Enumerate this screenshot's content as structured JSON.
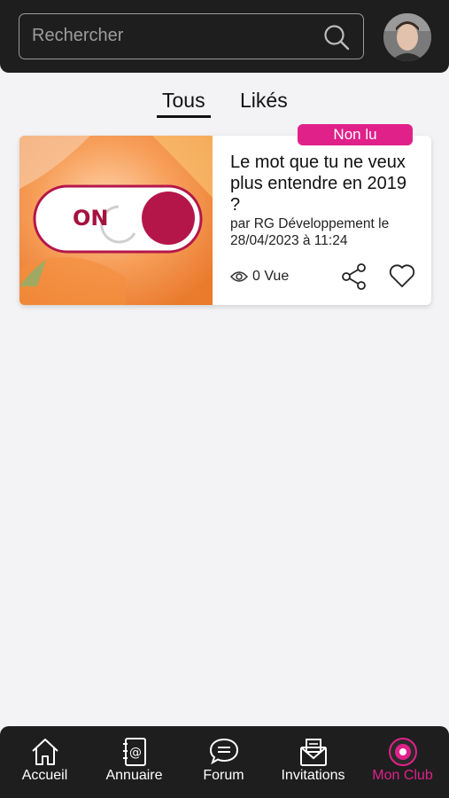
{
  "search": {
    "placeholder": "Rechercher"
  },
  "tabs": [
    {
      "label": "Tous",
      "active": true
    },
    {
      "label": "Likés",
      "active": false
    }
  ],
  "article": {
    "badge": "Non lu",
    "title": "Le mot que tu ne veux plus entendre en 2019 ?",
    "meta": "par RG Développement le 28/04/2023 à 11:24",
    "views": "0 Vue",
    "thumb_text": "ON"
  },
  "nav": [
    {
      "label": "Accueil",
      "icon": "home-icon"
    },
    {
      "label": "Annuaire",
      "icon": "address-book-icon"
    },
    {
      "label": "Forum",
      "icon": "chat-bubbles-icon"
    },
    {
      "label": "Invitations",
      "icon": "envelope-icon"
    },
    {
      "label": "Mon Club",
      "icon": "club-logo-icon",
      "active": true
    }
  ],
  "colors": {
    "accent": "#e0218a",
    "header_bg": "#1e1e1e",
    "page_bg": "#f3f3f6",
    "thumb_red": "#b5164a"
  }
}
